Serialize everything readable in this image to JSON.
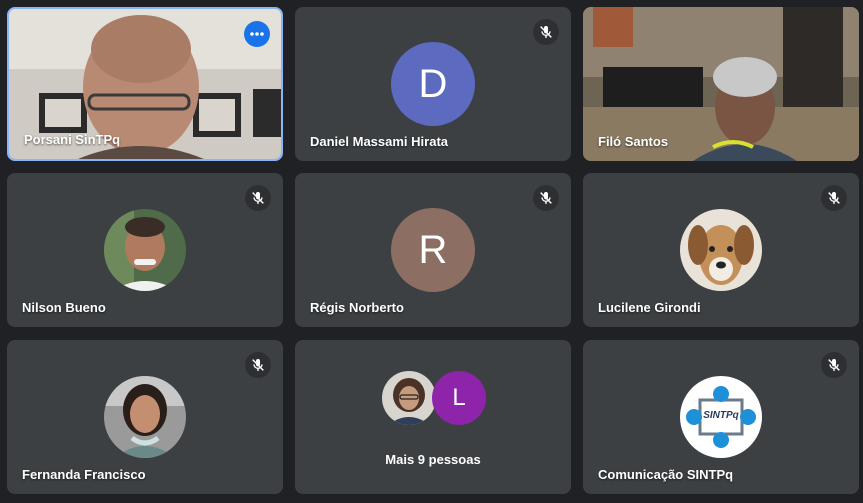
{
  "participants": [
    {
      "name": "Porsani SinTPq",
      "kind": "video",
      "active": true
    },
    {
      "name": "Daniel Massami Hirata",
      "kind": "letter",
      "letter": "D",
      "color": "#5c6bc0"
    },
    {
      "name": "Filó Santos",
      "kind": "video"
    },
    {
      "name": "Nilson Bueno",
      "kind": "photo"
    },
    {
      "name": "Régis Norberto",
      "kind": "letter",
      "letter": "R",
      "color": "#8d6e63"
    },
    {
      "name": "Lucilene Girondi",
      "kind": "photo"
    },
    {
      "name": "Fernanda Francisco",
      "kind": "photo"
    },
    {
      "name": "Comunicação SINTPq",
      "kind": "photo"
    }
  ],
  "overflow": {
    "label": "Mais 9 pessoas",
    "letter": "L",
    "color": "#8e24aa"
  },
  "logo_text": "SINTPq",
  "icons": {
    "mute": "mic-off-icon",
    "more": "more-options-icon"
  },
  "colors": {
    "background": "#202124",
    "tile": "#3c4043",
    "active_border": "#8ab4f8",
    "more_button": "#1a73e8"
  }
}
